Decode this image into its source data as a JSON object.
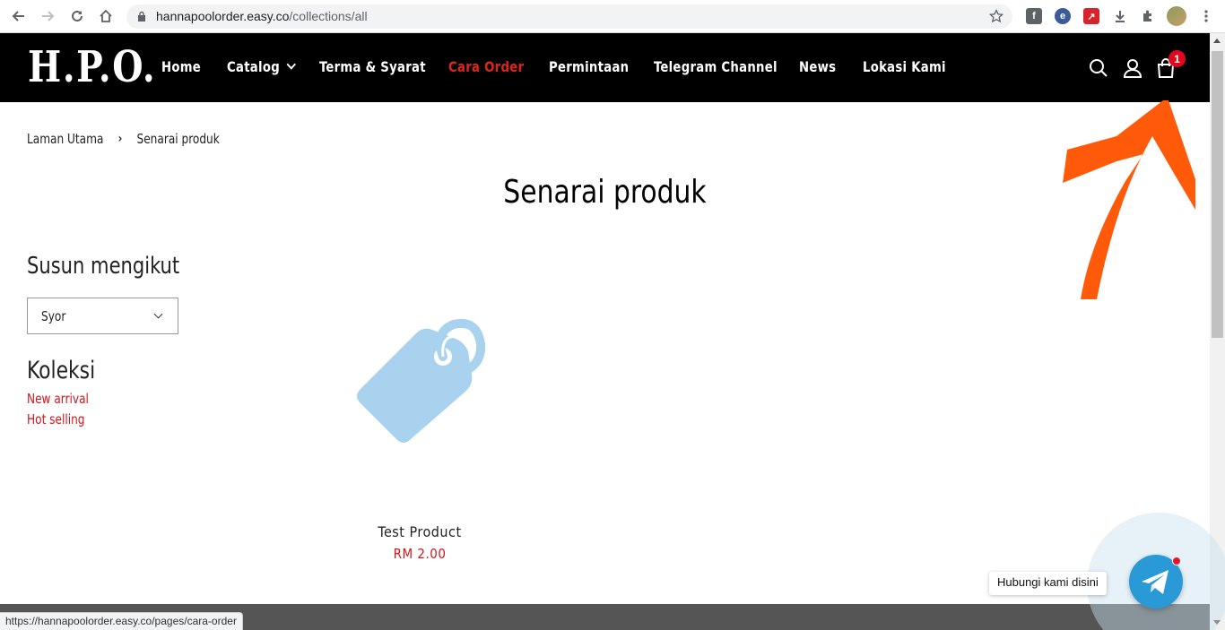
{
  "browser": {
    "url_host": "hannapoolorder.easy.co",
    "url_path": "/collections/all",
    "status_url": "https://hannapoolorder.easy.co/pages/cara-order"
  },
  "header": {
    "logo": "H.P.O.",
    "nav": [
      {
        "label": "Home"
      },
      {
        "label": "Catalog"
      },
      {
        "label": "Terma & Syarat"
      },
      {
        "label": "Cara Order"
      },
      {
        "label": "Permintaan"
      },
      {
        "label": "Telegram Channel"
      },
      {
        "label": "News"
      },
      {
        "label": "Lokasi Kami"
      }
    ],
    "cart_count": "1",
    "accent_color": "#e0261c"
  },
  "breadcrumb": {
    "home": "Laman Utama",
    "current": "Senarai produk"
  },
  "page": {
    "title": "Senarai produk"
  },
  "sidebar": {
    "sort_heading": "Susun mengikut",
    "sort_value": "Syor",
    "collections_heading": "Koleksi",
    "collections": [
      {
        "label": "New arrival"
      },
      {
        "label": "Hot selling"
      }
    ]
  },
  "products": [
    {
      "name": "Test Product",
      "price": "RM 2.00",
      "image_icon": "tag-icon"
    }
  ],
  "widget": {
    "tooltip": "Hubungi kami disini",
    "icon": "telegram-icon"
  }
}
